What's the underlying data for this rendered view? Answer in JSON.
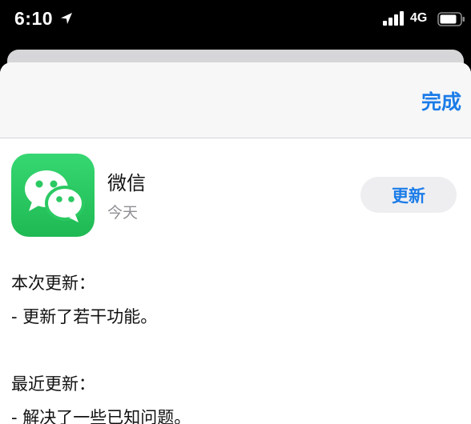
{
  "status_bar": {
    "time": "6:10",
    "network": "4G",
    "icons": [
      "location-arrow-icon",
      "signal-bars-icon",
      "battery-icon"
    ]
  },
  "nav": {
    "done_label": "完成"
  },
  "app": {
    "name": "微信",
    "date": "今天",
    "icon": "wechat-icon",
    "update_label": "更新"
  },
  "release_notes": {
    "current_heading": "本次更新：",
    "current_item": "- 更新了若干功能。",
    "recent_heading": "最近更新：",
    "recent_item": "- 解决了一些已知问题。"
  },
  "colors": {
    "accent": "#1b7ce8",
    "icon_green": "#2bc962",
    "secondary_text": "#8e8e93"
  }
}
